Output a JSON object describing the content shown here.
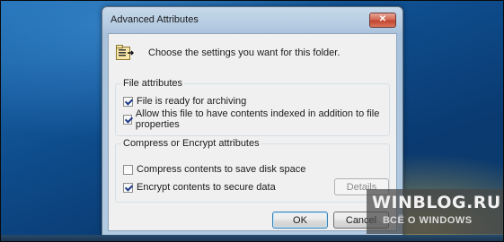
{
  "window": {
    "title": "Advanced Attributes",
    "close_glyph": "✕"
  },
  "header": {
    "icon": "folder-attributes-icon",
    "text": "Choose the settings you want for this folder."
  },
  "file_attributes": {
    "label": "File attributes",
    "options": [
      {
        "label": "File is ready for archiving",
        "checked": true
      },
      {
        "label": "Allow this file to have contents indexed in addition to file properties",
        "checked": true
      }
    ]
  },
  "compress_encrypt": {
    "label": "Compress or Encrypt attributes",
    "options": [
      {
        "label": "Compress contents to save disk space",
        "checked": false
      },
      {
        "label": "Encrypt contents to secure data",
        "checked": true
      }
    ],
    "details_label": "Details"
  },
  "buttons": {
    "ok": "OK",
    "cancel": "Cancel"
  },
  "watermark": {
    "line1": "WINBLOG.RU",
    "line2": "ВСЁ О WINDOWS"
  }
}
